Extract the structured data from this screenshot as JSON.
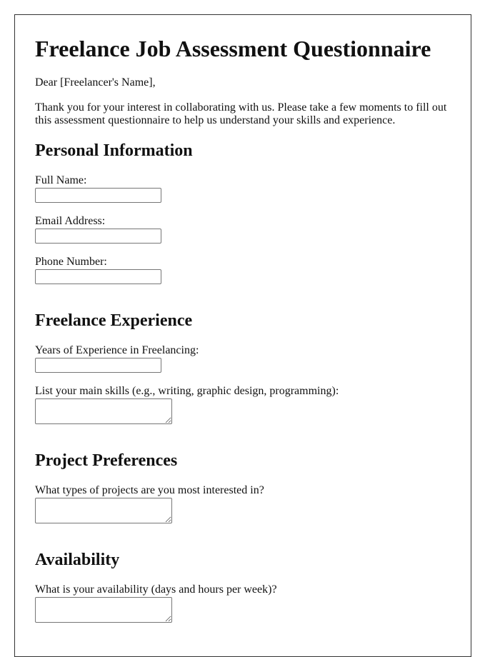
{
  "title": "Freelance Job Assessment Questionnaire",
  "greeting": "Dear [Freelancer's Name],",
  "intro": "Thank you for your interest in collaborating with us. Please take a few moments to fill out this assessment questionnaire to help us understand your skills and experience.",
  "sections": {
    "personal": {
      "heading": "Personal Information",
      "fields": [
        {
          "label": "Full Name:",
          "value": "",
          "placeholder": ""
        },
        {
          "label": "Email Address:",
          "value": "",
          "placeholder": ""
        },
        {
          "label": "Phone Number:",
          "value": "",
          "placeholder": ""
        }
      ]
    },
    "experience": {
      "heading": "Freelance Experience",
      "fields": [
        {
          "label": "Years of Experience in Freelancing:",
          "value": "",
          "placeholder": ""
        },
        {
          "label": "List your main skills (e.g., writing, graphic design, programming):",
          "value": "",
          "placeholder": ""
        }
      ]
    },
    "preferences": {
      "heading": "Project Preferences",
      "fields": [
        {
          "label": "What types of projects are you most interested in?",
          "value": "",
          "placeholder": ""
        }
      ]
    },
    "availability": {
      "heading": "Availability",
      "fields": [
        {
          "label": "What is your availability (days and hours per week)?",
          "value": "",
          "placeholder": ""
        }
      ]
    }
  }
}
